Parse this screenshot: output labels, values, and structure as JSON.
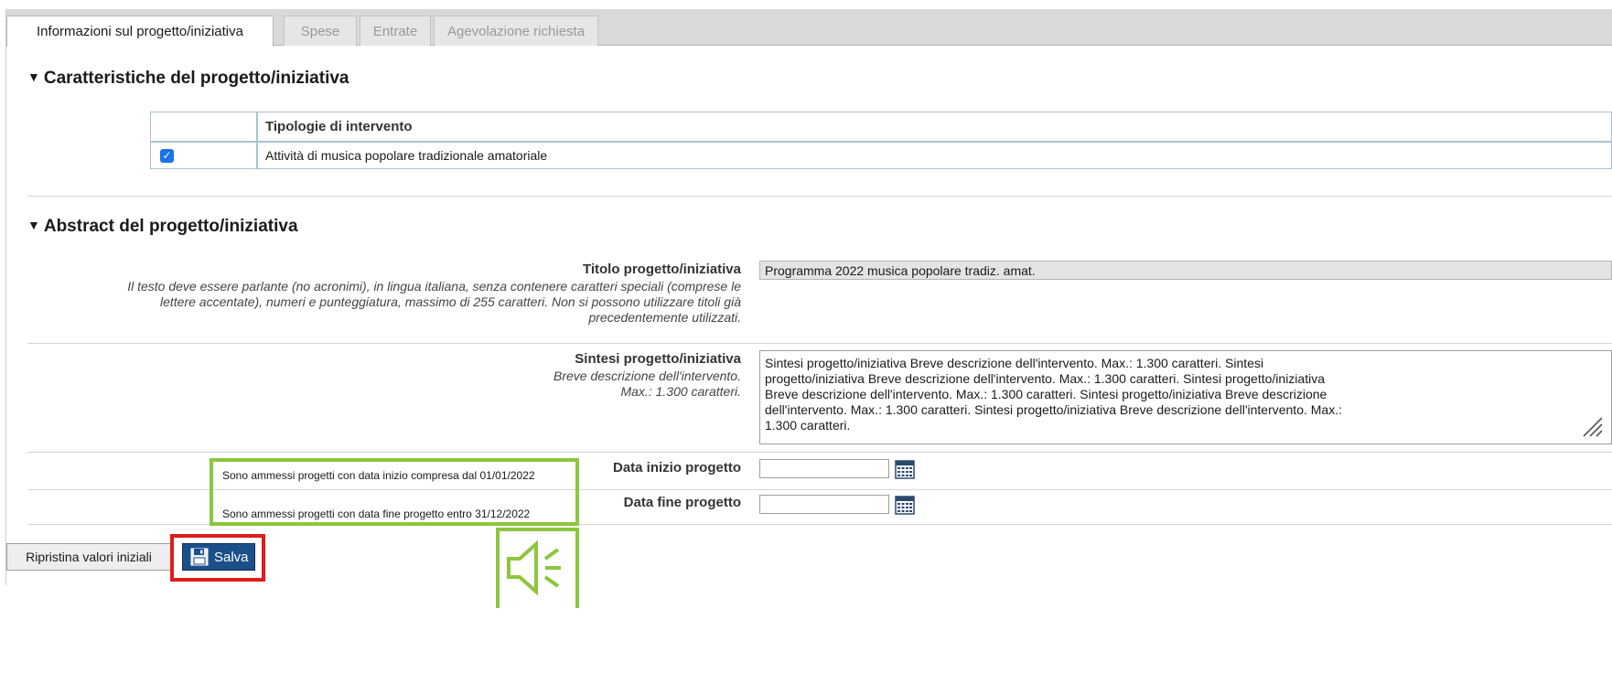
{
  "tabs": [
    {
      "label": "Informazioni sul progetto/iniziativa",
      "active": true
    },
    {
      "label": "Spese",
      "active": false
    },
    {
      "label": "Entrate",
      "active": false
    },
    {
      "label": "Agevolazione richiesta",
      "active": false
    }
  ],
  "section1": {
    "title": "Caratteristiche del progetto/iniziativa",
    "table_header": "Tipologie di intervento",
    "rows": [
      {
        "label": "Attività di musica popolare tradizionale amatoriale",
        "checked": true
      }
    ]
  },
  "section2": {
    "title": "Abstract del progetto/iniziativa",
    "titolo": {
      "label": "Titolo progetto/iniziativa",
      "hint_lines": [
        "Il testo deve essere parlante (no acronimi), in lingua italiana, senza contenere caratteri speciali (comprese le",
        "lettere accentate), numeri e punteggiatura, massimo di 255 caratteri. Non si possono utilizzare titoli già",
        "precedentemente utilizzati."
      ],
      "value": "Programma 2022 musica popolare tradiz. amat."
    },
    "sintesi": {
      "label": "Sintesi progetto/iniziativa",
      "hint_lines": [
        "Breve descrizione dell'intervento.",
        "Max.: 1.300 caratteri."
      ],
      "value_lines": [
        "Sintesi progetto/iniziativa Breve descrizione dell'intervento. Max.: 1.300 caratteri. Sintesi",
        "progetto/iniziativa Breve descrizione dell'intervento. Max.: 1.300 caratteri. Sintesi progetto/iniziativa",
        "Breve descrizione dell'intervento. Max.: 1.300 caratteri. Sintesi progetto/iniziativa Breve descrizione",
        "dell'intervento. Max.: 1.300 caratteri. Sintesi progetto/iniziativa Breve descrizione dell'intervento. Max.:",
        "1.300 caratteri."
      ]
    },
    "data_inizio": {
      "label": "Data inizio progetto",
      "value": "",
      "note": "Sono ammessi progetti con data inizio compresa dal 01/01/2022"
    },
    "data_fine": {
      "label": "Data fine progetto",
      "value": "",
      "note": "Sono ammessi progetti con data fine progetto entro 31/12/2022"
    }
  },
  "buttons": {
    "reset_label": "Ripristina valori iniziali",
    "save_label": "Salva"
  },
  "colors": {
    "highlight_green": "#8dc63f",
    "highlight_red": "#e01c1c",
    "save_button": "#1b4f8a",
    "table_row": "#b8d5de"
  },
  "icons": [
    "triangle-down-icon",
    "checkbox-icon",
    "calendar-icon",
    "floppy-disk-icon",
    "speaker-icon",
    "resize-grip-icon"
  ]
}
